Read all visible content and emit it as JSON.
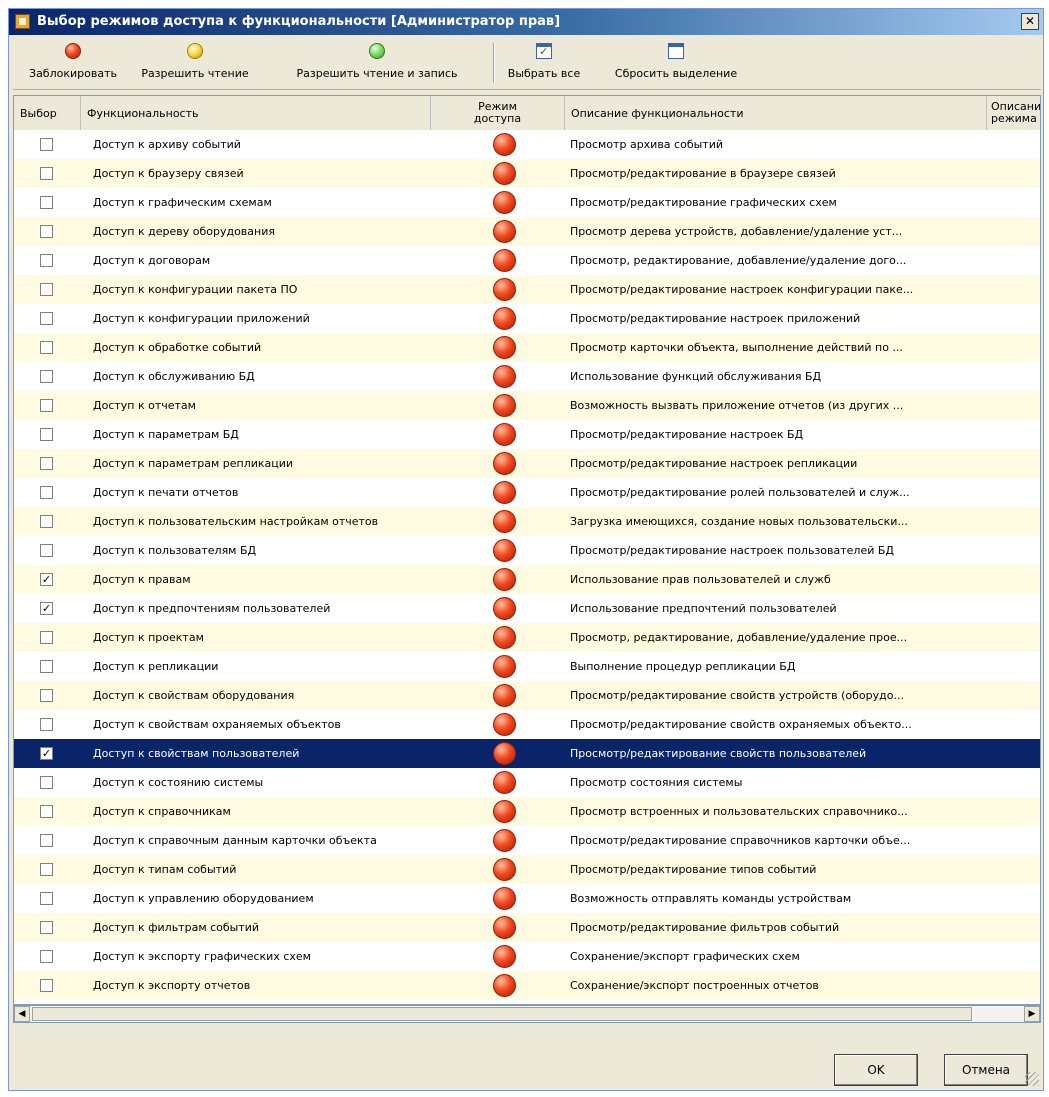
{
  "window": {
    "title": "Выбор режимов доступа к функциональности [Администратор прав]",
    "close_glyph": "✕"
  },
  "toolbar": [
    {
      "label": "Заблокировать",
      "icon": "red-circle-icon"
    },
    {
      "label": "Разрешить чтение",
      "icon": "yellow-circle-icon"
    },
    {
      "label": "Разрешить чтение и запись",
      "icon": "green-circle-icon"
    },
    {
      "label": "Выбрать все",
      "icon": "check-all-icon"
    },
    {
      "label": "Сбросить выделение",
      "icon": "uncheck-all-icon"
    }
  ],
  "columns": {
    "select": "Выбор",
    "func": "Функциональность",
    "mode": "Режим доступа",
    "desc": "Описание функциональности",
    "mode_desc": "Описание режима д"
  },
  "rows": [
    {
      "checked": false,
      "selected": false,
      "name": "Доступ к архиву событий",
      "desc": "Просмотр архива событий"
    },
    {
      "checked": false,
      "selected": false,
      "name": "Доступ к браузеру связей",
      "desc": "Просмотр/редактирование в браузере связей"
    },
    {
      "checked": false,
      "selected": false,
      "name": "Доступ к графическим схемам",
      "desc": "Просмотр/редактирование графических схем"
    },
    {
      "checked": false,
      "selected": false,
      "name": "Доступ к дереву оборудования",
      "desc": "Просмотр дерева устройств, добавление/удаление уст..."
    },
    {
      "checked": false,
      "selected": false,
      "name": "Доступ к договорам",
      "desc": "Просмотр, редактирование, добавление/удаление дого..."
    },
    {
      "checked": false,
      "selected": false,
      "name": "Доступ к конфигурации пакета ПО",
      "desc": "Просмотр/редактирование настроек конфигурации паке..."
    },
    {
      "checked": false,
      "selected": false,
      "name": "Доступ к конфигурации приложений",
      "desc": "Просмотр/редактирование настроек приложений"
    },
    {
      "checked": false,
      "selected": false,
      "name": "Доступ к обработке событий",
      "desc": "Просмотр карточки объекта, выполнение действий по ..."
    },
    {
      "checked": false,
      "selected": false,
      "name": "Доступ к обслуживанию БД",
      "desc": "Использование функций обслуживания БД"
    },
    {
      "checked": false,
      "selected": false,
      "name": "Доступ к отчетам",
      "desc": "Возможность вызвать приложение отчетов (из других ..."
    },
    {
      "checked": false,
      "selected": false,
      "name": "Доступ к параметрам БД",
      "desc": "Просмотр/редактирование настроек БД"
    },
    {
      "checked": false,
      "selected": false,
      "name": "Доступ к параметрам репликации",
      "desc": "Просмотр/редактирование настроек репликации"
    },
    {
      "checked": false,
      "selected": false,
      "name": "Доступ к печати отчетов",
      "desc": "Просмотр/редактирование ролей пользователей и служ..."
    },
    {
      "checked": false,
      "selected": false,
      "name": "Доступ к пользовательским настройкам отчетов",
      "desc": "Загрузка имеющихся, создание новых пользовательски..."
    },
    {
      "checked": false,
      "selected": false,
      "name": "Доступ к пользователям БД",
      "desc": "Просмотр/редактирование настроек пользователей БД"
    },
    {
      "checked": true,
      "selected": false,
      "name": "Доступ к правам",
      "desc": "Использование прав пользователей и служб"
    },
    {
      "checked": true,
      "selected": false,
      "name": "Доступ к предпочтениям пользователей",
      "desc": "Использование предпочтений пользователей"
    },
    {
      "checked": false,
      "selected": false,
      "name": "Доступ к проектам",
      "desc": "Просмотр, редактирование, добавление/удаление прое..."
    },
    {
      "checked": false,
      "selected": false,
      "name": "Доступ к репликации",
      "desc": "Выполнение процедур репликации БД"
    },
    {
      "checked": false,
      "selected": false,
      "name": "Доступ к свойствам оборудования",
      "desc": "Просмотр/редактирование свойств устройств (оборудо..."
    },
    {
      "checked": false,
      "selected": false,
      "name": "Доступ к свойствам охраняемых объектов",
      "desc": "Просмотр/редактирование свойств охраняемых объекто..."
    },
    {
      "checked": true,
      "selected": true,
      "name": "Доступ к свойствам пользователей",
      "desc": "Просмотр/редактирование свойств пользователей"
    },
    {
      "checked": false,
      "selected": false,
      "name": "Доступ к состоянию системы",
      "desc": "Просмотр состояния системы"
    },
    {
      "checked": false,
      "selected": false,
      "name": "Доступ к справочникам",
      "desc": "Просмотр встроенных и пользовательских справочнико..."
    },
    {
      "checked": false,
      "selected": false,
      "name": "Доступ к справочным данным карточки объекта",
      "desc": "Просмотр/редактирование справочников карточки объе..."
    },
    {
      "checked": false,
      "selected": false,
      "name": "Доступ к типам событий",
      "desc": "Просмотр/редактирование типов событий"
    },
    {
      "checked": false,
      "selected": false,
      "name": "Доступ к управлению оборудованием",
      "desc": "Возможность отправлять команды устройствам"
    },
    {
      "checked": false,
      "selected": false,
      "name": "Доступ к фильтрам событий",
      "desc": "Просмотр/редактирование фильтров событий"
    },
    {
      "checked": false,
      "selected": false,
      "name": "Доступ к экспорту графических схем",
      "desc": "Сохранение/экспорт графических схем"
    },
    {
      "checked": false,
      "selected": false,
      "name": "Доступ к экспорту отчетов",
      "desc": "Сохранение/экспорт построенных отчетов"
    }
  ],
  "row_mode_icon": "red-circle-icon",
  "scrollbar": {
    "left_glyph": "◀",
    "right_glyph": "▶"
  },
  "buttons": {
    "ok": "OK",
    "cancel": "Отмена"
  },
  "check_glyph": "✓"
}
